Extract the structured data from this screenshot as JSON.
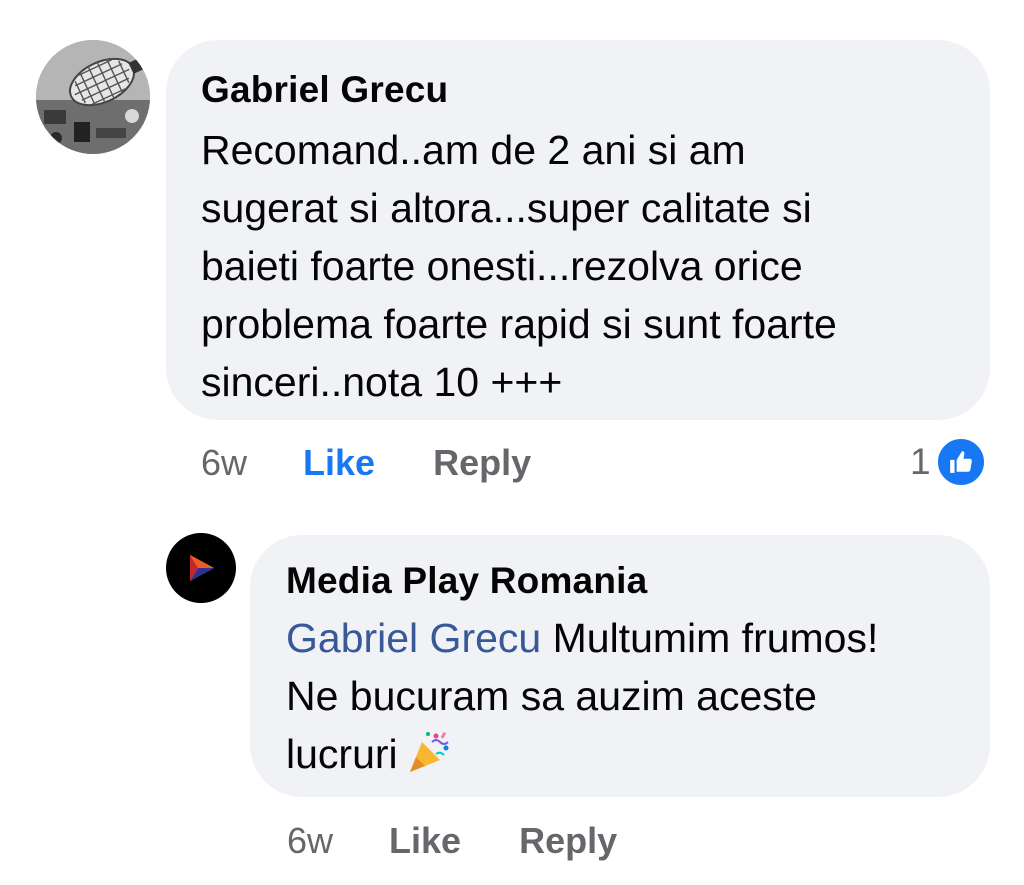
{
  "comment": {
    "author": "Gabriel Grecu",
    "text": "Recomand..am de 2 ani si am\nsugerat si altora...super calitate si\nbaieti foarte onesti...rezolva orice\nproblema foarte rapid si sunt foarte\nsinceri..nota 10 +++",
    "time": "6w",
    "like_label": "Like",
    "reply_label": "Reply",
    "reaction_count": "1",
    "reaction_icon": "thumbs-up-icon",
    "liked": true
  },
  "reply": {
    "author": "Media Play Romania",
    "mention": "Gabriel Grecu",
    "text_line1": " Multumim frumos!",
    "text_rest": "Ne bucuram sa auzim aceste",
    "text_last": "lucruri",
    "emoji": "party-popper-icon",
    "time": "6w",
    "like_label": "Like",
    "reply_label": "Reply"
  },
  "colors": {
    "bubble": "#f0f2f5",
    "accent": "#1877f2",
    "mention": "#385898",
    "muted": "#65676b"
  }
}
